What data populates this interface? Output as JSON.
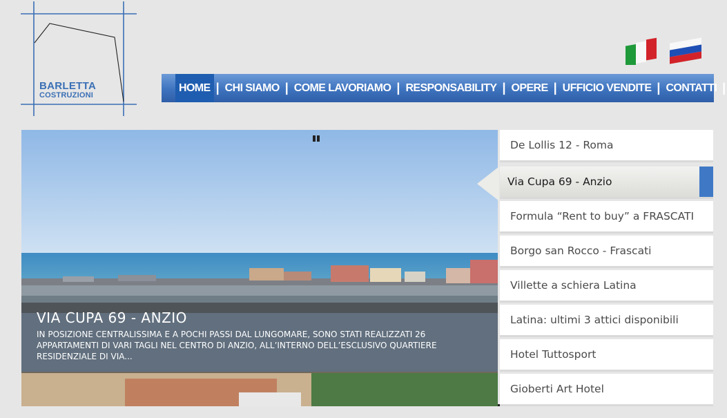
{
  "logo": {
    "name": "BARLETTA",
    "subtitle": "COSTRUZIONI"
  },
  "languages": [
    {
      "icon": "italy-flag-icon"
    },
    {
      "icon": "russia-flag-icon"
    }
  ],
  "nav": {
    "items": [
      {
        "label": "HOME"
      },
      {
        "label": "CHI SIAMO"
      },
      {
        "label": "COME LAVORIAMO"
      },
      {
        "label": "RESPONSABILITY"
      },
      {
        "label": "OPERE"
      },
      {
        "label": "UFFICIO VENDITE"
      },
      {
        "label": "CONTATTI"
      }
    ],
    "separator": "|",
    "accent_color": "#3e73be",
    "active_color": "#1f5db0"
  },
  "slider": {
    "title": "VIA CUPA 69 - ANZIO",
    "text": "In posizione centralissima e a pochi passi dal lungomare, sono stati realizzati 26 appartamenti  di vari tagli nel centro di Anzio, all’interno dell’esclusivo quartiere residenziale di via...",
    "pause_icon": "pause-icon"
  },
  "projects": [
    {
      "label": "De Lollis 12 - Roma"
    },
    {
      "label": "Via Cupa 69 - Anzio",
      "active": true
    },
    {
      "label": "Formula “Rent to buy” a FRASCATI"
    },
    {
      "label": "Borgo san Rocco - Frascati"
    },
    {
      "label": "Villette a schiera Latina"
    },
    {
      "label": "Latina: ultimi 3 attici disponibili"
    },
    {
      "label": "Hotel Tuttosport"
    },
    {
      "label": "Gioberti Art Hotel"
    }
  ]
}
